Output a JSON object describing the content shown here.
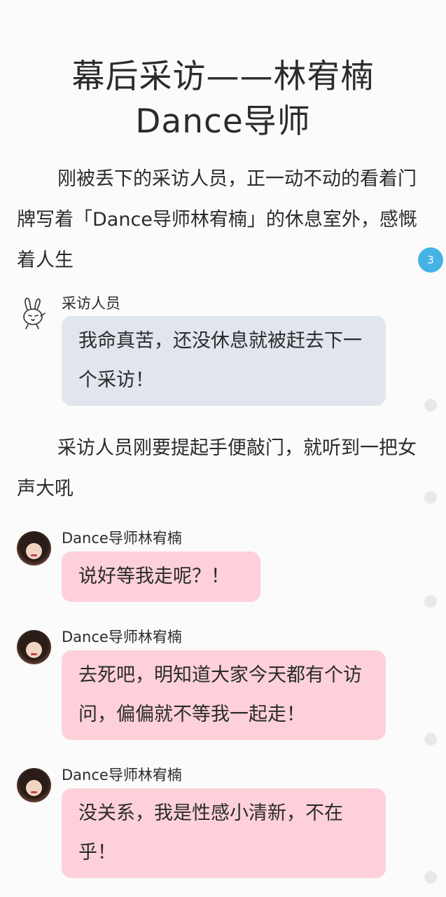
{
  "title": {
    "line1": "幕后采访——林宥楠",
    "line2": "Dance导师"
  },
  "paragraphs": [
    "刚被丢下的采访人员，正一动不动的看着门牌写着「Dance导师林宥楠」的休息室外，感慨着人生",
    "采访人员刚要提起手便敲门，就听到一把女声大吼"
  ],
  "messages": [
    {
      "speaker": "采访人员",
      "text": "我命真苦，还没休息就被赶去下一个采访！",
      "avatar": "bunny-icon"
    },
    {
      "speaker": "Dance导师林宥楠",
      "text": "说好等我走呢？！",
      "avatar": "portrait"
    },
    {
      "speaker": "Dance导师林宥楠",
      "text": "去死吧，明知道大家今天都有个访问，偏偏就不等我一起走！",
      "avatar": "portrait"
    },
    {
      "speaker": "Dance导师林宥楠",
      "text": "没关系，我是性感小清新，不在乎！",
      "avatar": "portrait"
    }
  ],
  "comment_badge": "3",
  "colors": {
    "gray_bubble": "#e1e5ee",
    "pink_bubble": "#fdd0da",
    "badge": "#46b3e6"
  }
}
